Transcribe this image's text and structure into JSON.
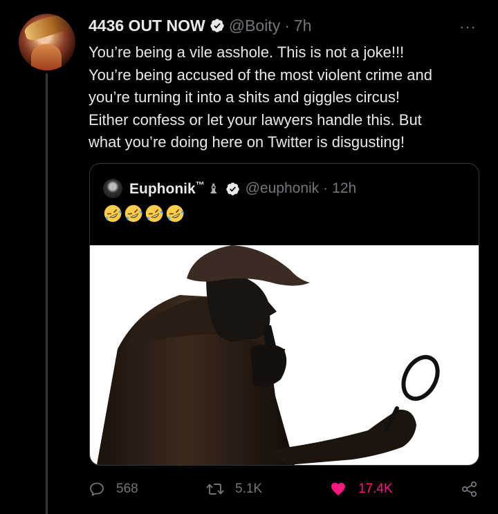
{
  "tweet": {
    "display_name": "4436 OUT NOW",
    "handle": "@Boity",
    "separator": "·",
    "time": "7h",
    "more_label": "···",
    "text_lines": [
      "You’re being a vile asshole. This is not a joke!!!",
      "You’re being accused of the most violent crime and",
      "you’re turning it into a shits and giggles circus!",
      "Either confess or let your lawyers handle this. But",
      "what you’re doing here on Twitter is disgusting!"
    ]
  },
  "quote": {
    "display_name": "Euphonik",
    "trademark": "™",
    "chess_piece": "♝",
    "handle": "@euphonik",
    "separator": "·",
    "time": "12h",
    "emoji_count": 4,
    "emoji_name": "rolling-on-the-floor-laughing"
  },
  "actions": {
    "replies": "568",
    "retweets": "5.1K",
    "likes": "17.4K"
  },
  "colors": {
    "background": "#000000",
    "text": "#e7e9ea",
    "secondary": "#71767b",
    "like": "#f91880",
    "border": "#333639"
  },
  "icons": [
    "reply-icon",
    "retweet-icon",
    "like-icon",
    "share-icon",
    "verified-icon",
    "more-icon"
  ]
}
